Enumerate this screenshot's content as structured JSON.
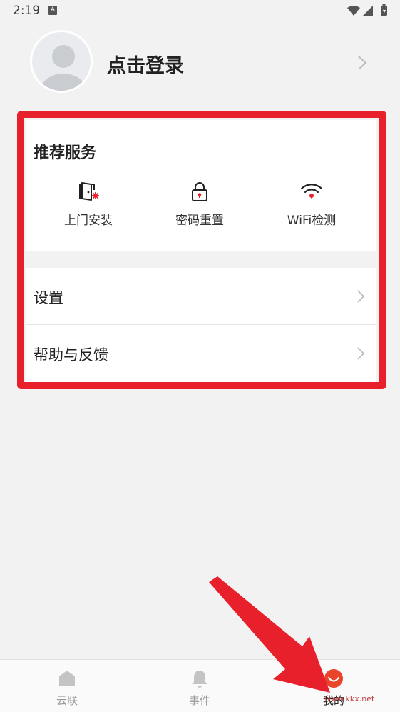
{
  "status_bar": {
    "time": "2:19",
    "notification_letter": "A"
  },
  "profile": {
    "login_label": "点击登录"
  },
  "services": {
    "title": "推荐服务",
    "items": [
      {
        "label": "上门安装",
        "icon": "door-install-icon"
      },
      {
        "label": "密码重置",
        "icon": "lock-icon"
      },
      {
        "label": "WiFi检测",
        "icon": "wifi-icon"
      }
    ]
  },
  "menu": {
    "items": [
      {
        "label": "设置"
      },
      {
        "label": "帮助与反馈"
      }
    ]
  },
  "bottom_nav": {
    "items": [
      {
        "label": "云联",
        "icon": "home-icon"
      },
      {
        "label": "事件",
        "icon": "bell-icon"
      },
      {
        "label": "我的",
        "icon": "smiley-icon",
        "active": true
      }
    ]
  },
  "watermark": "www.kkx.net",
  "colors": {
    "accent": "#e8202b",
    "background": "#f2f2f2"
  }
}
